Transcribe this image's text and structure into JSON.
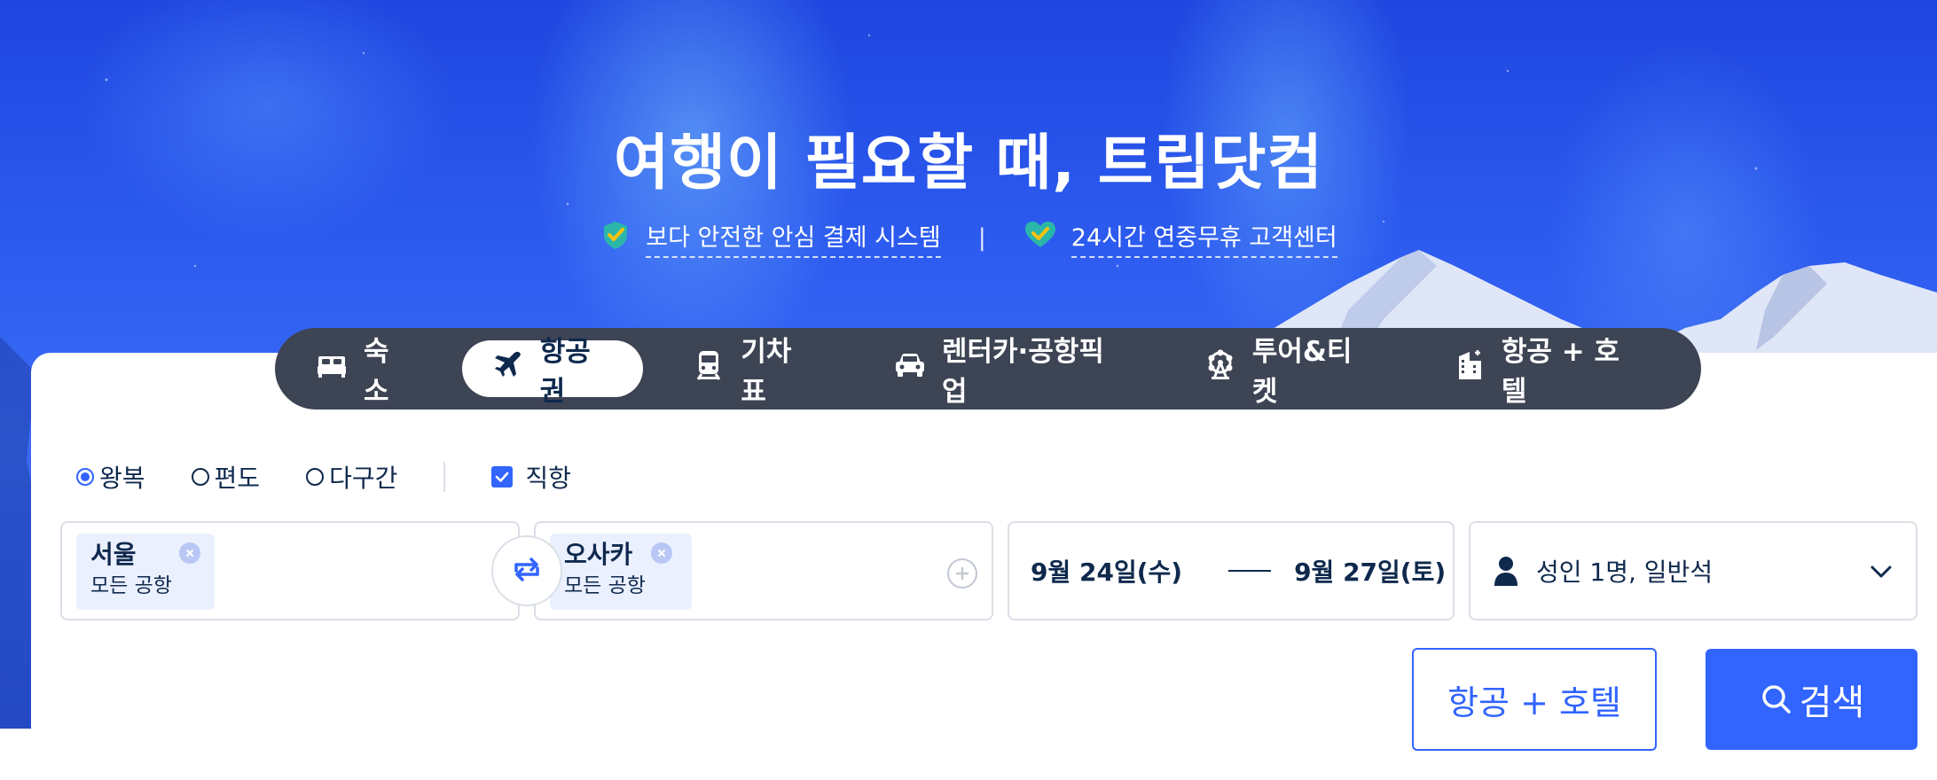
{
  "hero": {
    "title": "여행이 필요할 때, 트립닷컴",
    "trust_items": [
      {
        "icon": "shield-check-icon",
        "label": "보다 안전한 안심 결제 시스템"
      },
      {
        "icon": "heart-check-icon",
        "label": "24시간 연중무휴 고객센터"
      }
    ],
    "separator": "|"
  },
  "tabs": [
    {
      "icon": "bed-icon",
      "label": "숙소",
      "active": false
    },
    {
      "icon": "airplane-icon",
      "label": "항공권",
      "active": true
    },
    {
      "icon": "train-icon",
      "label": "기차표",
      "active": false
    },
    {
      "icon": "car-icon",
      "label": "렌터카·공항픽업",
      "active": false
    },
    {
      "icon": "ferris-wheel-icon",
      "label": "투어&티켓",
      "active": false
    },
    {
      "icon": "building-icon",
      "label": "항공 + 호텔",
      "active": false
    }
  ],
  "trip_type": {
    "options": [
      "왕복",
      "편도",
      "다구간"
    ],
    "selected": "왕복",
    "direct_label": "직항",
    "direct_checked": true
  },
  "origin": {
    "city": "서울",
    "airport": "모든 공항"
  },
  "destination": {
    "city": "오사카",
    "airport": "모든 공항"
  },
  "dates": {
    "depart": "9월 24일(수)",
    "return": "9월 27일(토)"
  },
  "passengers": {
    "label": "성인 1명, 일반석"
  },
  "buttons": {
    "flight_hotel": "항공 + 호텔",
    "search": "검색"
  },
  "colors": {
    "accent": "#3264ff",
    "tab_bar": "#3d4454",
    "text": "#0f294d"
  }
}
